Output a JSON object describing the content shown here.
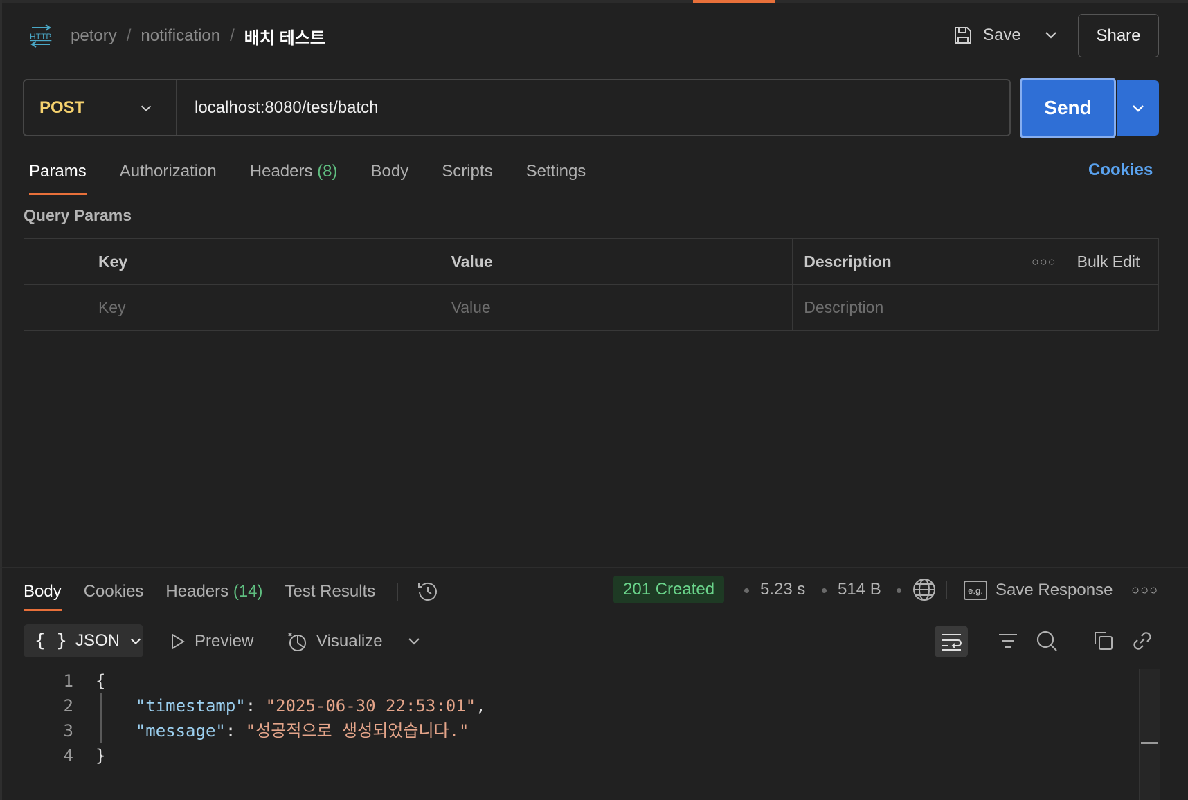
{
  "breadcrumb": {
    "icon": "http-icon",
    "items": [
      "petory",
      "notification"
    ],
    "separator": "/",
    "current": "배치 테스트"
  },
  "header": {
    "save_label": "Save",
    "share_label": "Share"
  },
  "request": {
    "method": "POST",
    "url": "localhost:8080/test/batch",
    "send_label": "Send",
    "colors": {
      "method": "#f6d26e",
      "send": "#2f6fd6"
    }
  },
  "request_tabs": [
    {
      "label": "Params",
      "count": ""
    },
    {
      "label": "Authorization",
      "count": ""
    },
    {
      "label": "Headers",
      "count": "(8)"
    },
    {
      "label": "Body",
      "count": ""
    },
    {
      "label": "Scripts",
      "count": ""
    },
    {
      "label": "Settings",
      "count": ""
    }
  ],
  "cookies_label": "Cookies",
  "query_params": {
    "title": "Query Params",
    "headers": {
      "key": "Key",
      "value": "Value",
      "description": "Description",
      "bulk_edit": "Bulk Edit"
    },
    "placeholders": {
      "key": "Key",
      "value": "Value",
      "description": "Description"
    }
  },
  "response_tabs": [
    {
      "label": "Body",
      "count": ""
    },
    {
      "label": "Cookies",
      "count": ""
    },
    {
      "label": "Headers",
      "count": "(14)"
    },
    {
      "label": "Test Results",
      "count": ""
    }
  ],
  "response_meta": {
    "status": "201 Created",
    "time": "5.23 s",
    "size": "514 B",
    "save_response": "Save Response",
    "eg_label": "e.g.",
    "status_color": "#6ad38a"
  },
  "response_toolbar": {
    "format": "JSON",
    "format_braces": "{ }",
    "preview": "Preview",
    "visualize": "Visualize"
  },
  "response_body": {
    "line_numbers": [
      "1",
      "2",
      "3",
      "4"
    ],
    "open_brace": "{",
    "close_brace": "}",
    "fields": [
      {
        "key": "\"timestamp\"",
        "value": "\"2025-06-30 22:53:01\"",
        "trail": ","
      },
      {
        "key": "\"message\"",
        "value": "\"성공적으로 생성되었습니다.\"",
        "trail": ""
      }
    ]
  }
}
